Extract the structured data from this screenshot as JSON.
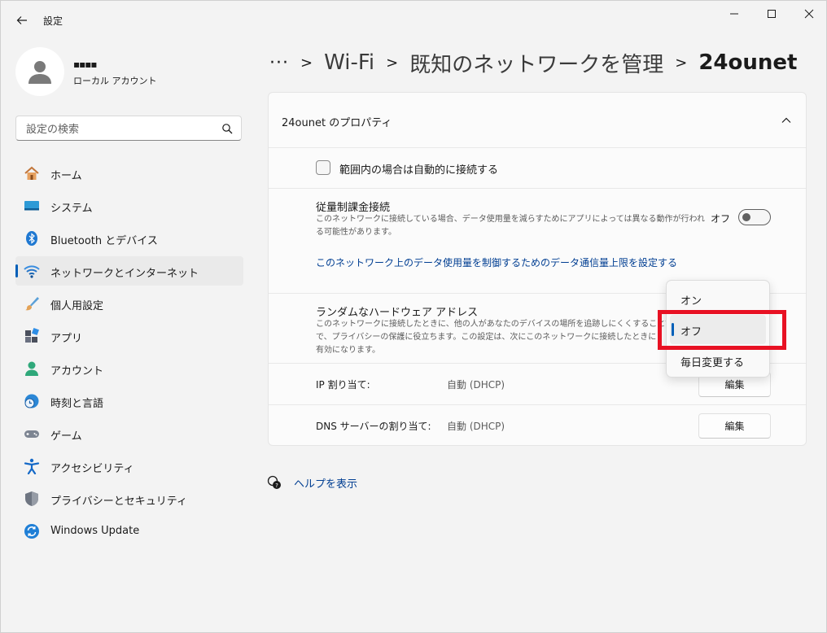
{
  "app": {
    "title": "設定"
  },
  "profile": {
    "user_name": "▪▪▪▪",
    "account_type": "ローカル アカウント"
  },
  "search": {
    "placeholder": "設定の検索"
  },
  "sidebar": {
    "items": [
      {
        "label": "ホーム",
        "icon": "home-icon"
      },
      {
        "label": "システム",
        "icon": "system-icon"
      },
      {
        "label": "Bluetooth とデバイス",
        "icon": "bluetooth-icon"
      },
      {
        "label": "ネットワークとインターネット",
        "icon": "wifi-icon",
        "selected": true
      },
      {
        "label": "個人用設定",
        "icon": "brush-icon"
      },
      {
        "label": "アプリ",
        "icon": "apps-icon"
      },
      {
        "label": "アカウント",
        "icon": "account-icon"
      },
      {
        "label": "時刻と言語",
        "icon": "clock-globe-icon"
      },
      {
        "label": "ゲーム",
        "icon": "gamepad-icon"
      },
      {
        "label": "アクセシビリティ",
        "icon": "accessibility-icon"
      },
      {
        "label": "プライバシーとセキュリティ",
        "icon": "shield-icon"
      },
      {
        "label": "Windows Update",
        "icon": "update-icon"
      }
    ]
  },
  "breadcrumb": {
    "more": "···",
    "wifi": "Wi-Fi",
    "known_networks": "既知のネットワークを管理",
    "current": "24ounet"
  },
  "card": {
    "title": "24ounet のプロパティ",
    "auto_connect_label": "範囲内の場合は自動的に接続する",
    "metered": {
      "title": "従量制課金接続",
      "desc_line1": "このネットワークに接続している場合、データ使用量を減らすためにアプリによっては異なる動作が行われ",
      "desc_line2": "る可能性があります。",
      "toggle_state": "オフ",
      "link": "このネットワーク上のデータ使用量を制御するためのデータ通信量上限を設定する"
    },
    "random_hw": {
      "title": "ランダムなハードウェア アドレス",
      "desc_line1": "このネットワークに接続したときに、他の人があなたのデバイスの場所を追跡しにくくすることで",
      "desc_line2": "で、プライバシーの保護に役立ちます。この設定は、次にこのネットワークに接続したときに",
      "desc_line3": "有効になります。"
    },
    "ip": {
      "label": "IP 割り当て:",
      "value": "自動 (DHCP)",
      "edit": "編集"
    },
    "dns": {
      "label": "DNS サーバーの割り当て:",
      "value": "自動 (DHCP)",
      "edit": "編集"
    }
  },
  "dropdown": {
    "options": [
      "オン",
      "オフ",
      "毎日変更する"
    ],
    "selected": "オフ"
  },
  "help": {
    "label": "ヘルプを表示"
  },
  "colors": {
    "accent": "#005fb8",
    "link": "#003e92",
    "highlight": "#e81123"
  }
}
